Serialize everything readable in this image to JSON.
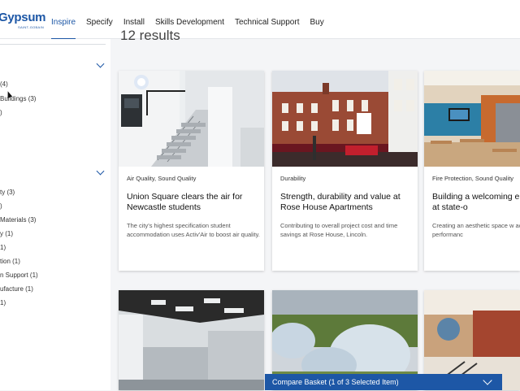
{
  "header": {
    "logo_text": "Gypsum",
    "logo_sub": "SAINT-GOBAIN",
    "nav": [
      {
        "label": "Inspire",
        "active": true
      },
      {
        "label": "Specify"
      },
      {
        "label": "Install"
      },
      {
        "label": "Skills Development"
      },
      {
        "label": "Technical Support"
      },
      {
        "label": "Buy"
      }
    ]
  },
  "sidebar": {
    "group1": [
      "(4)",
      "Buildings (3)",
      ")"
    ],
    "group2": [
      "ty (3)",
      ")",
      "Materials (3)",
      "y (1)",
      "1)",
      "tion (1)",
      "n Support (1)",
      "ufacture (1)",
      "1)"
    ]
  },
  "results": {
    "count_text": "12 results",
    "cards": [
      {
        "tag": "Air Quality, Sound Quality",
        "title": "Union Square clears the air for Newcastle students",
        "desc": "The city's highest specification student accommodation uses Activ'Air to boost air quality."
      },
      {
        "tag": "Durability",
        "title": "Strength, durability and value at Rose House Apartments",
        "desc": "Contributing to overall project cost and time savings at Rose House, Lincoln."
      },
      {
        "tag": "Fire Protection, Sound Quality",
        "title": "Building a welcoming environment at state-o",
        "desc": "Creating an aesthetic space w acoustic and fire performanc"
      }
    ]
  },
  "compare": {
    "label": "Compare Basket (1 of 3 Selected Item)"
  },
  "colors": {
    "brand": "#1d57a6"
  }
}
